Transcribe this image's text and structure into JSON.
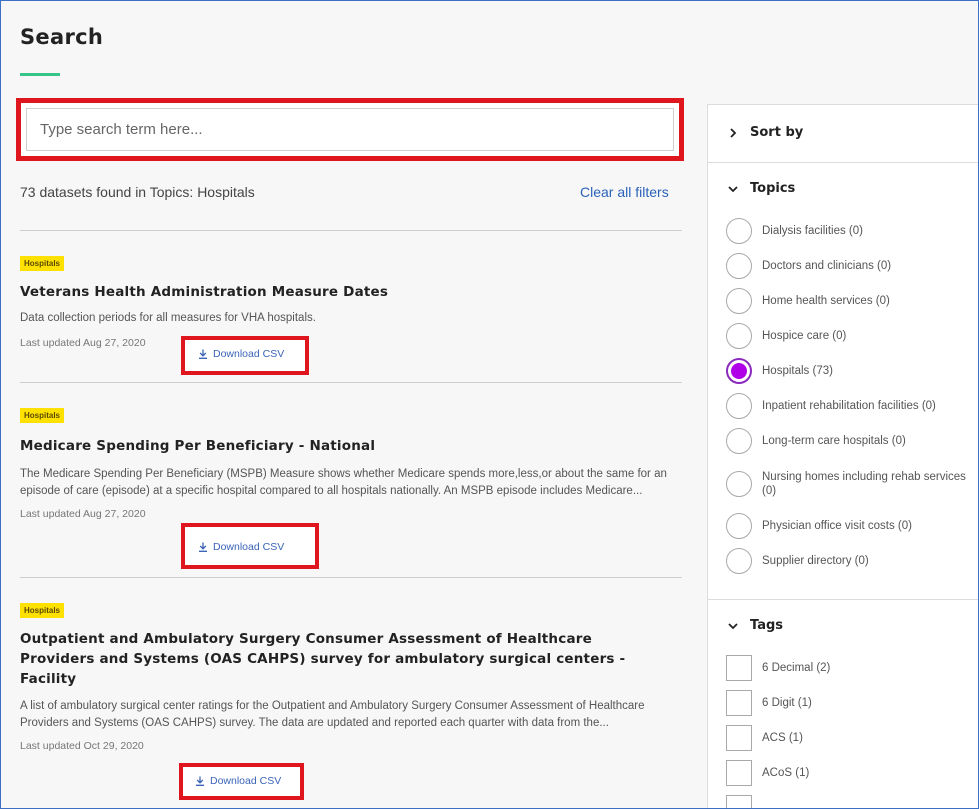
{
  "header": {
    "title": "Search"
  },
  "search": {
    "placeholder": "Type search term here..."
  },
  "results": {
    "count_text": "73 datasets found in Topics: Hospitals",
    "clear_filters": "Clear all filters"
  },
  "datasets": [
    {
      "tag": "Hospitals",
      "title": "Veterans Health Administration Measure Dates",
      "description": "Data collection periods for all measures for VHA hospitals.",
      "updated": "Last updated Aug 27, 2020",
      "download": "Download CSV"
    },
    {
      "tag": "Hospitals",
      "title": "Medicare Spending Per Beneficiary - National",
      "description": "The Medicare Spending Per Beneficiary (MSPB) Measure shows whether Medicare spends more,less,or about the same for an episode of care (episode) at a specific hospital compared to all hospitals nationally. An MSPB episode includes Medicare...",
      "updated": "Last updated Aug 27, 2020",
      "download": "Download CSV"
    },
    {
      "tag": "Hospitals",
      "title": "Outpatient and Ambulatory Surgery Consumer Assessment of Healthcare Providers and Systems (OAS CAHPS) survey for ambulatory surgical centers - Facility",
      "description": "A list of ambulatory surgical center ratings for the Outpatient and Ambulatory Surgery Consumer Assessment of Healthcare Providers and Systems (OAS CAHPS) survey. The data are updated and reported each quarter with data from the...",
      "updated": "Last updated Oct 29, 2020",
      "download": "Download CSV"
    }
  ],
  "sidebar": {
    "sort_by": "Sort by",
    "topics_heading": "Topics",
    "topics": [
      {
        "label": "Dialysis facilities (0)",
        "checked": false
      },
      {
        "label": "Doctors and clinicians (0)",
        "checked": false
      },
      {
        "label": "Home health services (0)",
        "checked": false
      },
      {
        "label": "Hospice care (0)",
        "checked": false
      },
      {
        "label": "Hospitals (73)",
        "checked": true
      },
      {
        "label": "Inpatient rehabilitation facilities (0)",
        "checked": false
      },
      {
        "label": "Long-term care hospitals (0)",
        "checked": false
      },
      {
        "label": "Nursing homes including rehab services (0)",
        "checked": false
      },
      {
        "label": "Physician office visit costs (0)",
        "checked": false
      },
      {
        "label": "Supplier directory (0)",
        "checked": false
      }
    ],
    "tags_heading": "Tags",
    "tags": [
      {
        "label": "6 Decimal (2)"
      },
      {
        "label": "6 Digit (1)"
      },
      {
        "label": "ACS (1)"
      },
      {
        "label": "ACoS (1)"
      }
    ]
  },
  "colors": {
    "accent_green": "#35c489",
    "highlight_red": "#e0161f",
    "badge_yellow": "#ffe100",
    "link_blue": "#2a62b8",
    "radio_selected": "#b000e8"
  }
}
